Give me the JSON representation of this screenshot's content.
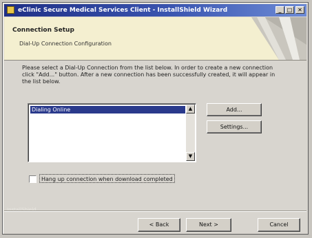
{
  "window": {
    "title": "eClinic Secure Medical Services Client - InstallShield Wizard",
    "controls": {
      "minimize": "_",
      "maximize": "□",
      "close": "✕"
    }
  },
  "header": {
    "title": "Connection Setup",
    "subtitle": "Dial-Up Connection Configuration"
  },
  "body": {
    "instructions": "Please select a Dial-Up Connection from the list below. In order to create a new connection click \"Add...\" button. After a new connection has been successfully created, it will appear in the list below."
  },
  "connection_list": {
    "items": [
      "Dialing Online"
    ],
    "selected_index": 0
  },
  "buttons": {
    "add": "Add...",
    "settings": "Settings...",
    "back": "< Back",
    "next": "Next >",
    "cancel": "Cancel"
  },
  "checkbox": {
    "label": "Hang up connection when download completed",
    "checked": false
  },
  "brand": "InstallShield",
  "icons": {
    "app": "app-icon",
    "scroll_up": "scroll-up-icon",
    "scroll_down": "scroll-down-icon"
  },
  "colors": {
    "title_bar_start": "#1f2f86",
    "title_bar_end": "#6d8bd6",
    "header_bg": "#f4efd0",
    "selection": "#2a3a8c",
    "dialog_bg": "#d8d5cf"
  }
}
